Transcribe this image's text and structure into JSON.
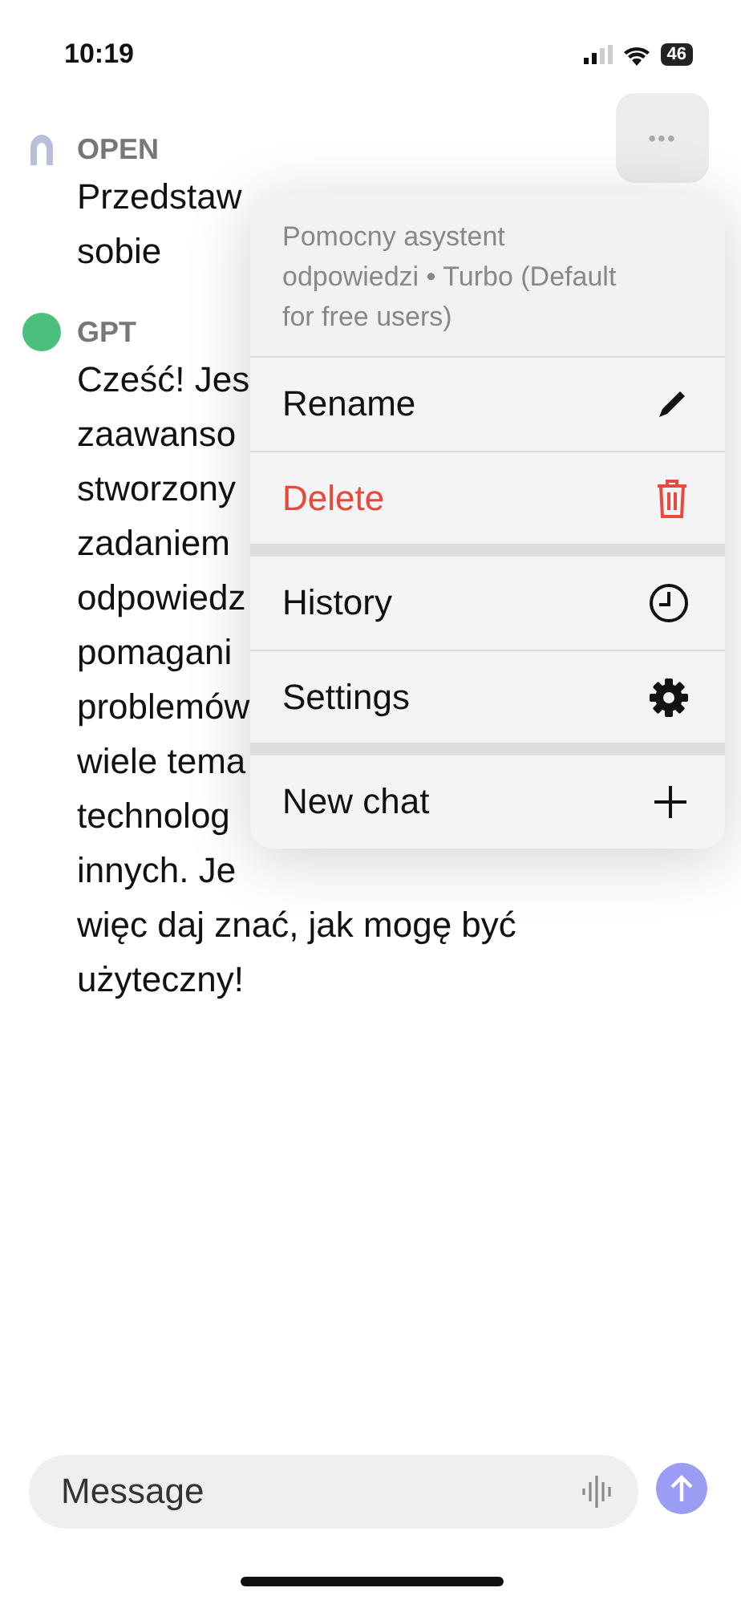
{
  "status_bar": {
    "time": "10:19",
    "battery": "46"
  },
  "messages": [
    {
      "kind": "user",
      "author": "OPEN",
      "lines": [
        "Przedstaw",
        "sobie"
      ]
    },
    {
      "kind": "assistant",
      "author": "GPT",
      "color": "#4cbf7d",
      "lines": [
        "Cześć! Jes",
        "zaawanso",
        "stworzony",
        "zadaniem",
        "odpowiedz",
        "pomagani",
        "problemów",
        "wiele tema",
        "technolog",
        "innych. Je",
        "więc daj znać, jak mogę być",
        "użyteczny!"
      ]
    }
  ],
  "more_button": {
    "label": "•••"
  },
  "menu": {
    "description": "Pomocny asystent odpowiedzi • Turbo (Default for free users)",
    "groups": [
      [
        {
          "label": "Rename",
          "kind": "rename",
          "destructive": false
        },
        {
          "label": "Delete",
          "kind": "delete",
          "destructive": true
        }
      ],
      [
        {
          "label": "History",
          "kind": "history",
          "destructive": false
        },
        {
          "label": "Settings",
          "kind": "settings",
          "destructive": false
        }
      ],
      [
        {
          "label": "New chat",
          "kind": "new",
          "destructive": false
        }
      ]
    ]
  },
  "composer": {
    "placeholder": "Message"
  }
}
